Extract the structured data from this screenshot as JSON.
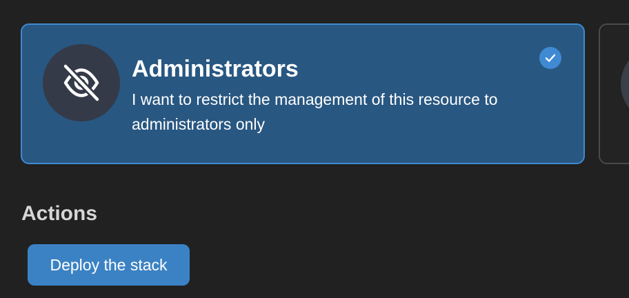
{
  "access_options": {
    "selected": {
      "icon": "eye-slash-icon",
      "title": "Administrators",
      "description": "I want to restrict the management of this resource to administrators only",
      "checked": true
    }
  },
  "actions": {
    "section_title": "Actions",
    "deploy_label": "Deploy the stack"
  },
  "colors": {
    "background": "#212121",
    "selected_card": "#285781",
    "accent": "#3f8ad2",
    "button": "#3b82c4",
    "icon_circle": "#343a47"
  }
}
